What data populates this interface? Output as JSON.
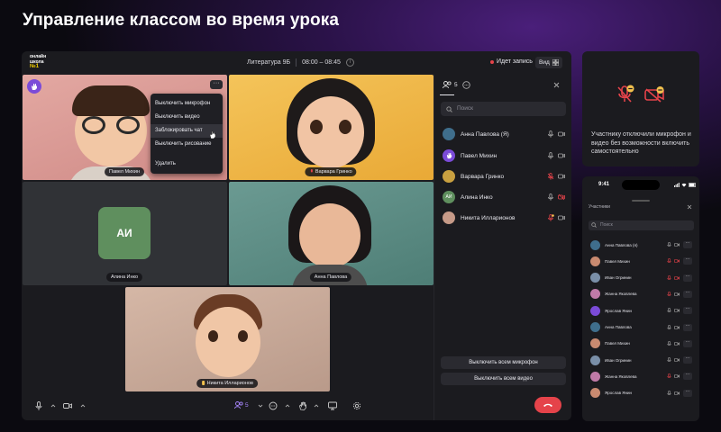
{
  "heading": "Управление классом во время урока",
  "app": {
    "logo": {
      "line1": "онлайн",
      "line2": "школа",
      "line3": "№1"
    },
    "lesson_title": "Литература 9Б",
    "lesson_time": "08:00 – 08:45",
    "info_icon": "i",
    "recording_label": "Идет запись",
    "view_label": "Вид",
    "tiles": [
      {
        "name": "Павел Михин"
      },
      {
        "name": "Варвара Гринко"
      },
      {
        "name": "Алина Инко",
        "initials": "АИ"
      },
      {
        "name": "Анна Павлова"
      },
      {
        "name": "Никита Илларионов"
      }
    ],
    "tile_more_label": "···",
    "context_menu": [
      "Выключить микрофон",
      "Выключить видео",
      "Заблокировать чат",
      "Выключить рисование",
      "Удалить"
    ],
    "panel": {
      "participants_count": "5",
      "search_placeholder": "Поиск",
      "participants": [
        {
          "name": "Анна Павлова (Я)",
          "color": "#3f6e8c",
          "initials": ""
        },
        {
          "name": "Павел Михин",
          "color": "#7b4bd8",
          "initials": ""
        },
        {
          "name": "Варвара Гринко",
          "color": "#c9a040",
          "initials": ""
        },
        {
          "name": "Алина Инко",
          "color": "#5f8f5e",
          "initials": "АИ"
        },
        {
          "name": "Никита Илларионов",
          "color": "#c69a88",
          "initials": ""
        }
      ],
      "mute_all_label": "Выключить всем микрофон",
      "video_off_all_label": "Выключить всем видео"
    },
    "bottom": {
      "participants_count": "5"
    }
  },
  "info_card": {
    "text": "Участнику отключили микрофон и видео без возможности включить самостоятельно"
  },
  "phone": {
    "time": "9:41",
    "title": "Участники",
    "search_placeholder": "Поиск",
    "more_label": "···",
    "rows": [
      {
        "name": "Анна Павлова (я)",
        "color": "#3f6e8c"
      },
      {
        "name": "Павел Михин",
        "color": "#c98a70"
      },
      {
        "name": "Иван Огринин",
        "color": "#7a8fa8"
      },
      {
        "name": "Жанна Яковлева",
        "color": "#c07aa8"
      },
      {
        "name": "Ярослав Янин",
        "color": "#7b4bd8"
      },
      {
        "name": "Анна Павлова",
        "color": "#3f6e8c"
      },
      {
        "name": "Павел Михин",
        "color": "#c98a70"
      },
      {
        "name": "Иван Огринин",
        "color": "#7a8fa8"
      },
      {
        "name": "Жанна Яковлева",
        "color": "#c07aa8"
      },
      {
        "name": "Ярослав Янин",
        "color": "#c98a70"
      }
    ]
  },
  "colors": {
    "accent": "#7b4bd8",
    "danger": "#e5434a",
    "panel": "#1b1b1f"
  }
}
